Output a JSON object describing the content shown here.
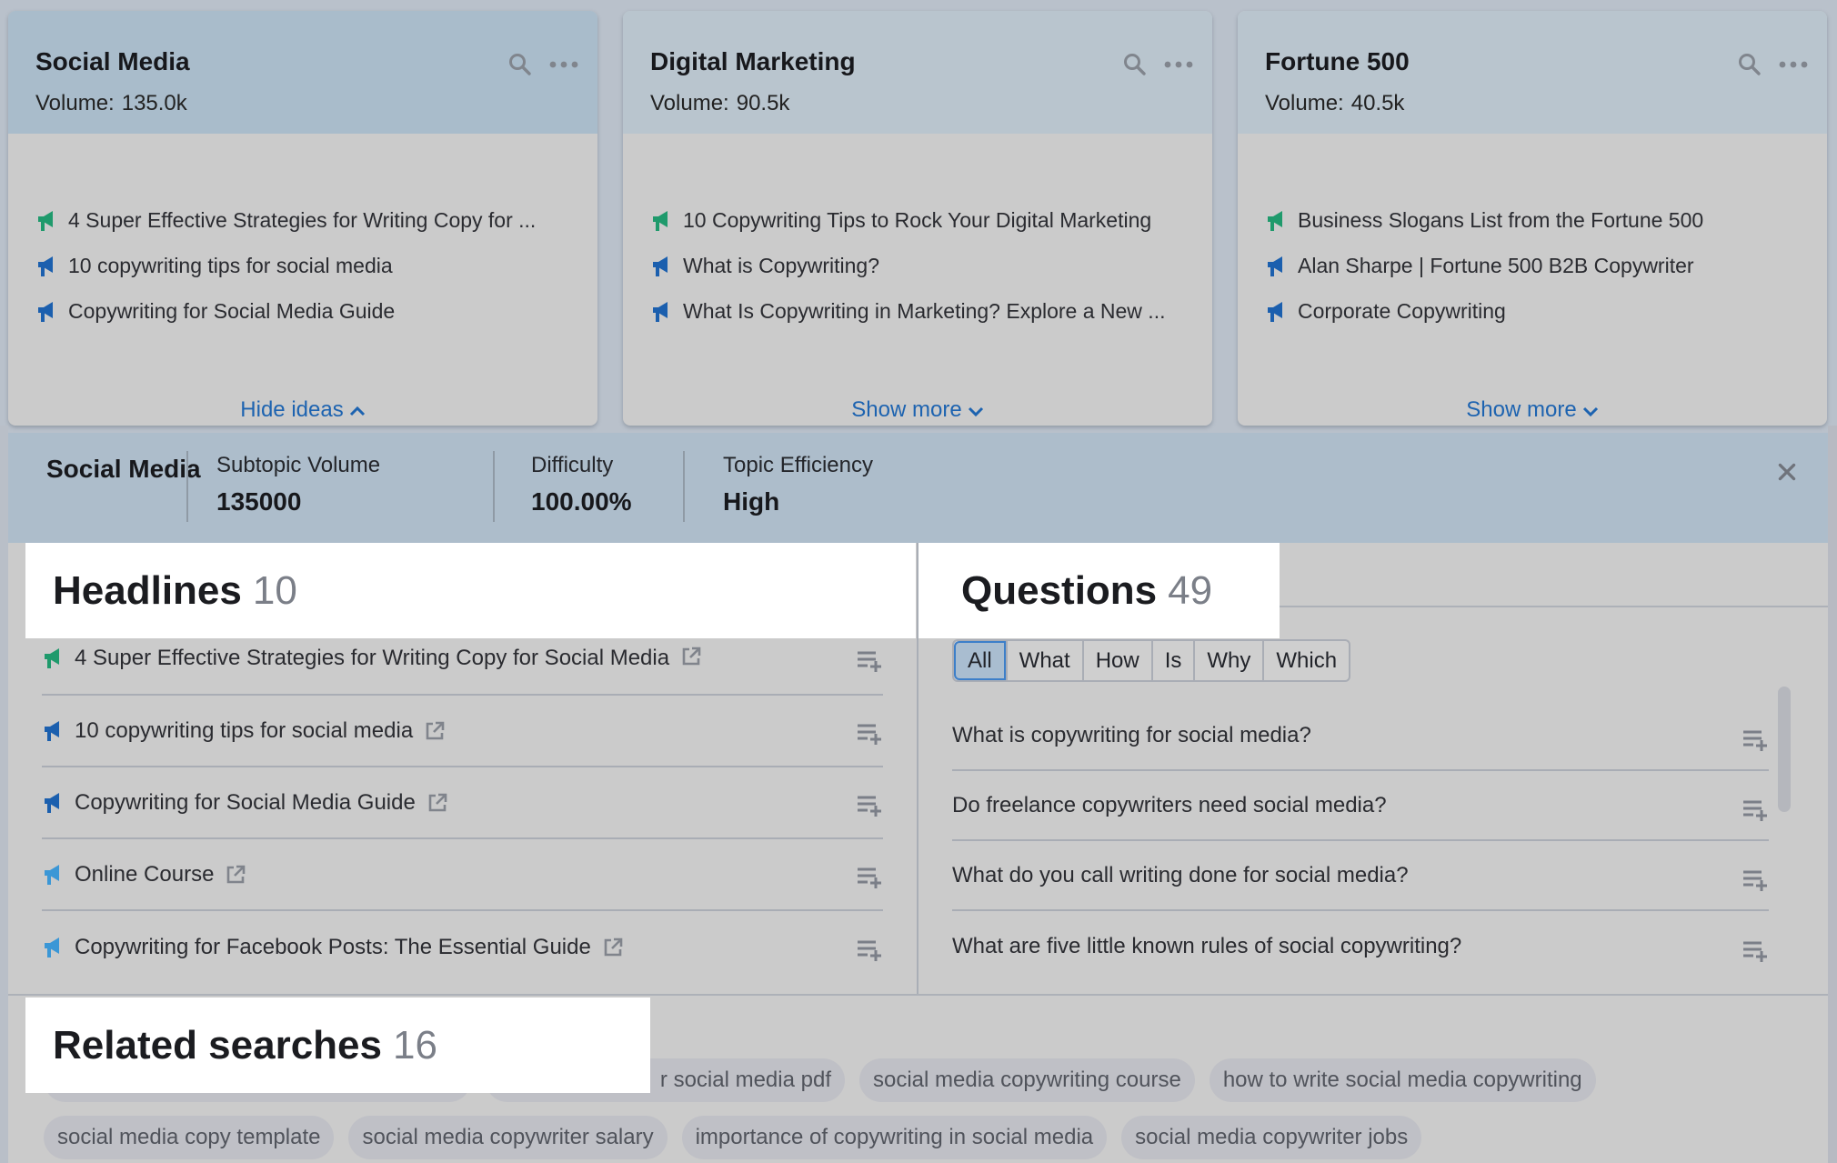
{
  "colors": {
    "link": "#1d63b0",
    "mega_green": "#1f9a6c",
    "mega_blue": "#1b5fae",
    "mega_lightblue": "#3b97d6",
    "active_filter": "#3d7fc9"
  },
  "cards": [
    {
      "title": "Social Media",
      "volume_label": "Volume:",
      "volume": "135.0k",
      "ideas": [
        {
          "text": "4 Super Effective Strategies for Writing Copy for ...",
          "icon": "megaphone-icon",
          "color": "green"
        },
        {
          "text": "10 copywriting tips for social media",
          "icon": "megaphone-icon",
          "color": "blue"
        },
        {
          "text": "Copywriting for Social Media Guide",
          "icon": "megaphone-icon",
          "color": "blue"
        }
      ],
      "toggle_label": "Hide ideas",
      "toggle_icon": "chevron-up-icon"
    },
    {
      "title": "Digital Marketing",
      "volume_label": "Volume:",
      "volume": "90.5k",
      "ideas": [
        {
          "text": "10 Copywriting Tips to Rock Your Digital Marketing",
          "icon": "megaphone-icon",
          "color": "green"
        },
        {
          "text": "What is Copywriting?",
          "icon": "megaphone-icon",
          "color": "blue"
        },
        {
          "text": "What Is Copywriting in Marketing? Explore a New ...",
          "icon": "megaphone-icon",
          "color": "blue"
        }
      ],
      "toggle_label": "Show more",
      "toggle_icon": "chevron-down-icon"
    },
    {
      "title": "Fortune 500",
      "volume_label": "Volume:",
      "volume": "40.5k",
      "ideas": [
        {
          "text": "Business Slogans List from the Fortune 500",
          "icon": "megaphone-icon",
          "color": "green"
        },
        {
          "text": "Alan Sharpe | Fortune 500 B2B Copywriter",
          "icon": "megaphone-icon",
          "color": "blue"
        },
        {
          "text": "Corporate Copywriting",
          "icon": "megaphone-icon",
          "color": "blue"
        }
      ],
      "toggle_label": "Show more",
      "toggle_icon": "chevron-down-icon"
    }
  ],
  "summary": {
    "title": "Social Media",
    "metrics": [
      {
        "label": "Subtopic Volume",
        "value": "135000"
      },
      {
        "label": "Difficulty",
        "value": "100.00%"
      },
      {
        "label": "Topic Efficiency",
        "value": "High"
      }
    ],
    "close_icon": "close-icon"
  },
  "headlines": {
    "title": "Headlines",
    "count": "10",
    "items": [
      {
        "text": "4 Super Effective Strategies for Writing Copy for Social Media",
        "color": "green"
      },
      {
        "text": "10 copywriting tips for social media",
        "color": "blue"
      },
      {
        "text": "Copywriting for Social Media Guide",
        "color": "blue"
      },
      {
        "text": "Online Course",
        "color": "lightblue"
      },
      {
        "text": "Copywriting for Facebook Posts: The Essential Guide",
        "color": "lightblue"
      }
    ]
  },
  "questions": {
    "title": "Questions",
    "count": "49",
    "filters": [
      "All",
      "What",
      "How",
      "Is",
      "Why",
      "Which"
    ],
    "active_filter": "All",
    "items": [
      "What is copywriting for social media?",
      "Do freelance copywriters need social media?",
      "What do you call writing done for social media?",
      "What are five little known rules of social copywriting?"
    ]
  },
  "related": {
    "title": "Related searches",
    "count": "16",
    "row1": [
      "",
      "r social media pdf",
      "social media copywriting course",
      "how to write social media copywriting"
    ],
    "row2": [
      "social media copy template",
      "social media copywriter salary",
      "importance of copywriting in social media",
      "social media copywriter jobs"
    ]
  }
}
